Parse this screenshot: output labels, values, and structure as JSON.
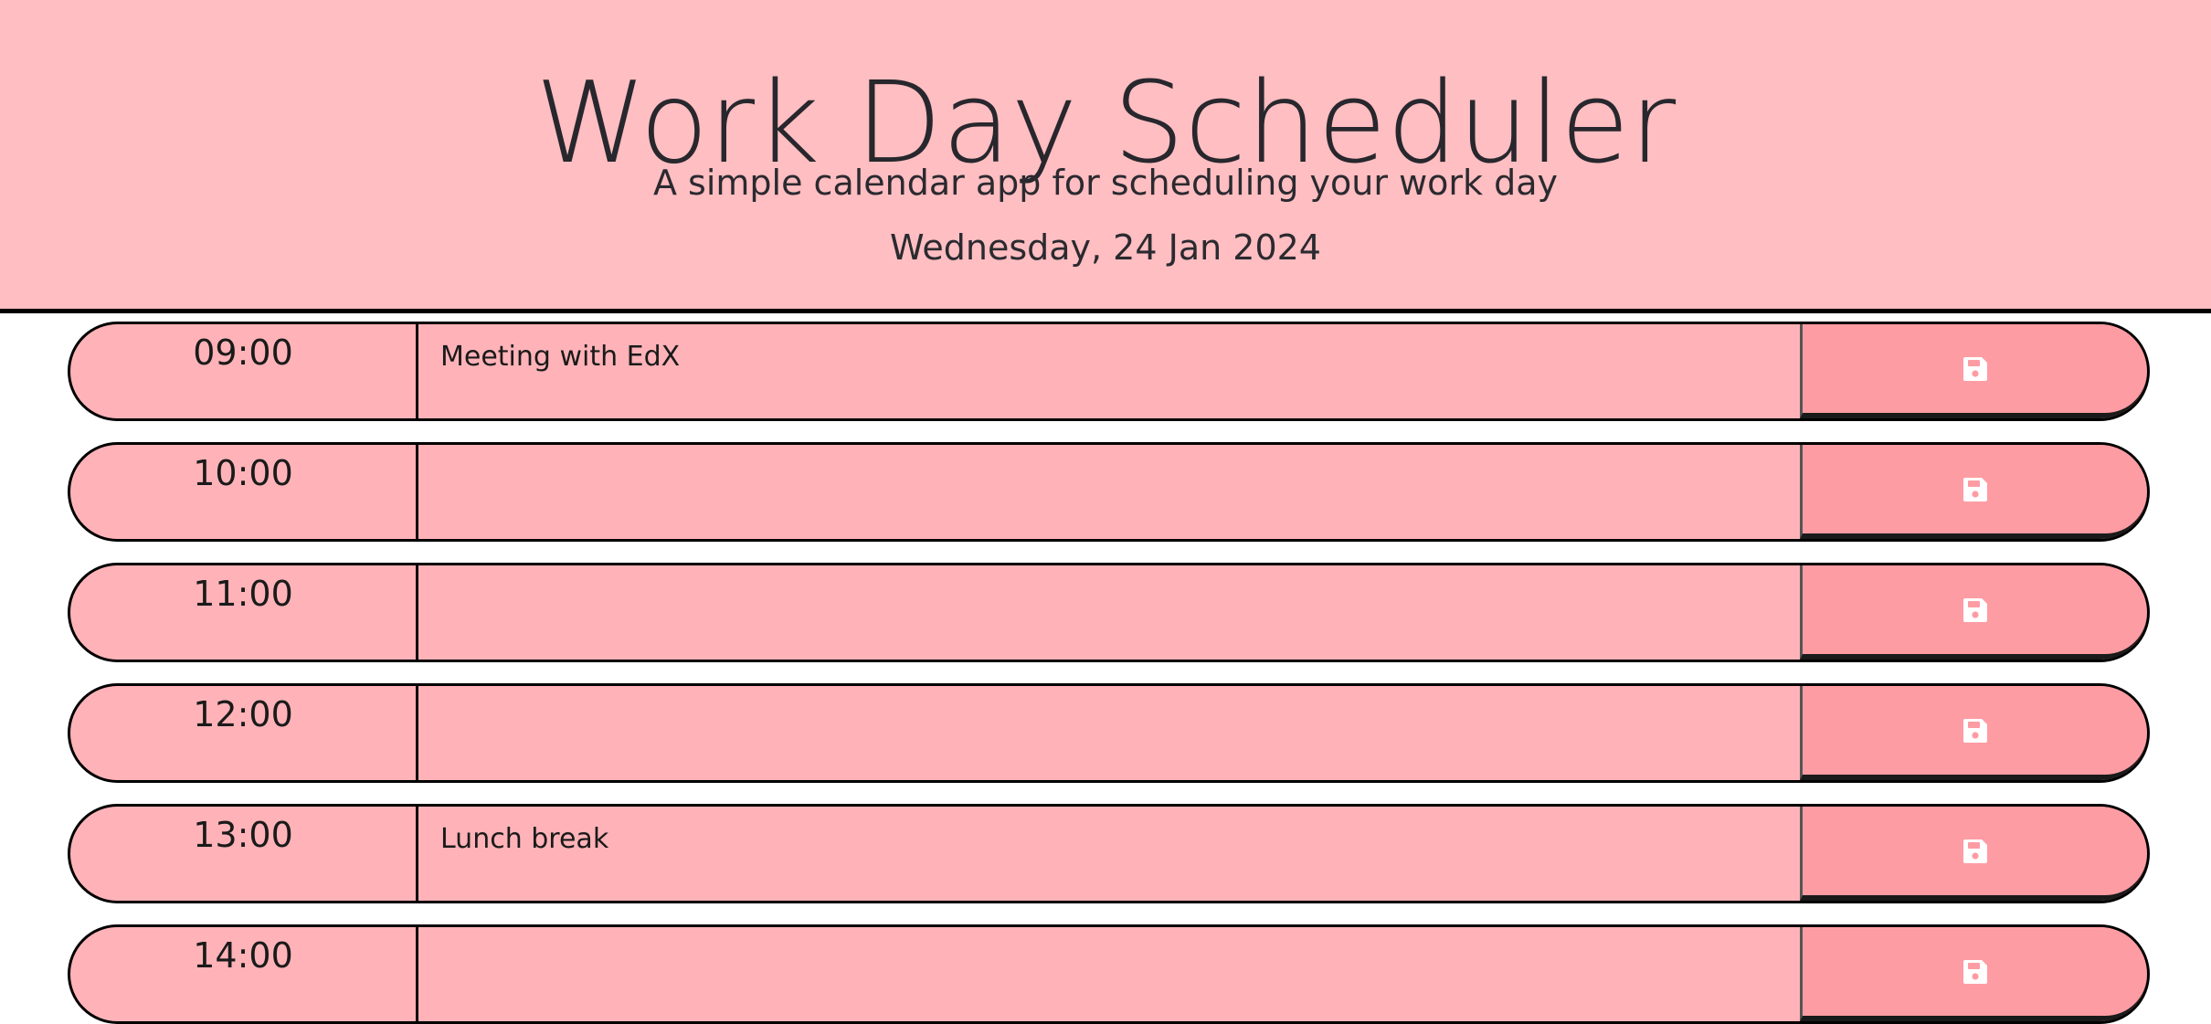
{
  "header": {
    "title": "Work Day Scheduler",
    "subtitle": "A simple calendar app for scheduling your work day",
    "current_day": "Wednesday, 24 Jan 2024"
  },
  "rows": [
    {
      "hour": "09:00",
      "text": "Meeting with EdX"
    },
    {
      "hour": "10:00",
      "text": ""
    },
    {
      "hour": "11:00",
      "text": ""
    },
    {
      "hour": "12:00",
      "text": ""
    },
    {
      "hour": "13:00",
      "text": "Lunch break"
    },
    {
      "hour": "14:00",
      "text": ""
    }
  ],
  "save_icon": "floppy-disk-icon",
  "colors": {
    "header_background": "#ffbec1",
    "row_background": "#ffb3b8",
    "save_button": "#fe9ca3",
    "icon": "#ffffff"
  }
}
